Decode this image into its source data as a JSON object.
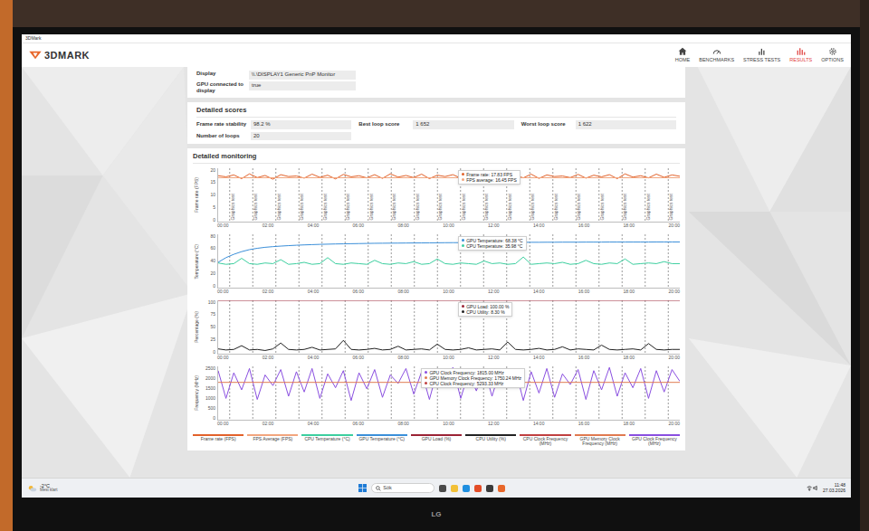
{
  "window": {
    "title": "3DMark"
  },
  "app": {
    "logo": "3DMARK"
  },
  "nav": [
    {
      "label": "HOME",
      "kind": "home",
      "selected": false
    },
    {
      "label": "BENCHMARKS",
      "kind": "gauge",
      "selected": false
    },
    {
      "label": "STRESS TESTS",
      "kind": "bars",
      "selected": false
    },
    {
      "label": "RESULTS",
      "kind": "results",
      "selected": true
    },
    {
      "label": "OPTIONS",
      "kind": "gear",
      "selected": false
    }
  ],
  "display_info": [
    {
      "label": "Display",
      "value": "\\\\.\\DISPLAY1 Generic PnP Monitor"
    },
    {
      "label": "GPU connected to display",
      "value": "true"
    }
  ],
  "scores": {
    "title": "Detailed scores",
    "items": [
      {
        "label": "Frame rate stability",
        "value": "98.2 %"
      },
      {
        "label": "Best loop score",
        "value": "1 652"
      },
      {
        "label": "Worst loop score",
        "value": "1 622"
      },
      {
        "label": "Number of loops",
        "value": "20"
      }
    ]
  },
  "monitoring": {
    "title": "Detailed monitoring",
    "markers": [
      "Graphics test",
      "Graphics test",
      "Graphics test",
      "Graphics test",
      "Graphics test",
      "Graphics test",
      "Graphics test",
      "Graphics test",
      "Graphics test",
      "Graphics test",
      "Graphics test",
      "Graphics test",
      "Graphics test",
      "Graphics test",
      "Graphics test",
      "Graphics test",
      "Graphics test",
      "Graphics test",
      "Graphics test",
      "Graphics test"
    ],
    "x_ticks": [
      "00:00",
      "02:00",
      "04:00",
      "06:00",
      "08:00",
      "10:00",
      "12:00",
      "14:00",
      "16:00",
      "18:00",
      "20:00"
    ],
    "charts": [
      {
        "axis_title": "Frame rate (FPS)",
        "y_ticks": [
          "0",
          "5",
          "10",
          "15",
          "20"
        ],
        "series": [
          {
            "name": "Frame rate",
            "color": "#e2622b",
            "values": [
              17.2,
              16.8,
              17.5,
              16.1,
              17.9,
              16.5,
              17.3,
              15.9,
              17.6,
              16.9,
              17.1,
              16.3,
              17.8,
              16.6,
              17.4,
              16.0,
              17.7,
              16.8,
              17.2,
              16.4,
              17.6,
              16.2,
              17.9,
              16.7,
              17.3,
              16.5,
              17.8,
              16.1,
              17.4,
              16.9,
              17.6,
              16.3,
              17.2,
              16.8,
              17.9,
              16.0,
              17.5,
              16.6,
              17.3,
              16.4,
              17.8,
              16.2,
              17.5,
              16.9,
              17.1,
              16.5,
              17.7,
              16.3,
              17.4,
              16.8,
              17.6,
              16.1,
              17.9,
              16.7,
              17.2,
              16.4,
              17.8,
              16.6,
              17.5,
              17.0
            ]
          },
          {
            "name": "FPS average",
            "color": "#f2a57e",
            "values": [
              16.45,
              16.45
            ]
          }
        ],
        "tooltip": [
          {
            "text": "Frame rate: 17.83 FPS",
            "color": "#e2622b"
          },
          {
            "text": "FPS average: 16.45 FPS",
            "color": "#f2a57e"
          }
        ],
        "tooltip_x": 0.52
      },
      {
        "axis_title": "Temperature (°C)",
        "y_ticks": [
          "0",
          "20",
          "40",
          "60",
          "80"
        ],
        "series": [
          {
            "name": "GPU Temperature",
            "color": "#3b8fd9",
            "values": [
              38,
              45,
              50,
              54,
              57,
              59,
              60.5,
              61.5,
              62.3,
              63,
              63.6,
              64.1,
              64.5,
              64.9,
              65.2,
              65.5,
              65.7,
              65.9,
              66.1,
              66.3,
              66.5,
              66.6,
              66.7,
              66.8,
              66.9,
              67,
              67.1,
              67.2,
              67.3,
              67.4,
              67.5,
              67.5,
              67.6,
              67.7,
              67.7,
              67.8,
              67.8,
              67.9,
              67.9,
              68,
              68,
              68,
              68.1,
              68.1,
              68.2,
              68.2,
              68.2,
              68.3,
              68.3,
              68.3,
              68.4,
              68.4,
              68.4,
              68.4,
              68.4,
              68.4,
              68.5,
              68.5,
              68.5,
              68.5
            ]
          },
          {
            "name": "CPU Temperature",
            "color": "#3ccf9f",
            "values": [
              37,
              35,
              36,
              44,
              36,
              35,
              37,
              36,
              42,
              35,
              36,
              38,
              35,
              36,
              45,
              36,
              35,
              37,
              36,
              35,
              41,
              36,
              35,
              37,
              36,
              39,
              35,
              36,
              43,
              36,
              35,
              37,
              36,
              35,
              40,
              36,
              37,
              35,
              36,
              46,
              35,
              36,
              37,
              36,
              38,
              35,
              36,
              41,
              36,
              35,
              37,
              36,
              43,
              35,
              36,
              37,
              36,
              39,
              36,
              36
            ]
          }
        ],
        "tooltip": [
          {
            "text": "GPU Temperature: 68.38 °C",
            "color": "#3b8fd9"
          },
          {
            "text": "CPU Temperature: 35.98 °C",
            "color": "#3ccf9f"
          }
        ],
        "tooltip_x": 0.52
      },
      {
        "axis_title": "Percentage (%)",
        "y_ticks": [
          "0",
          "25",
          "50",
          "75",
          "100"
        ],
        "series": [
          {
            "name": "GPU Load",
            "color": "#9b2335",
            "values": [
              100,
              100
            ]
          },
          {
            "name": "CPU Utility",
            "color": "#222222",
            "values": [
              9,
              7,
              8,
              15,
              7,
              8,
              6,
              9,
              20,
              8,
              7,
              8,
              12,
              7,
              8,
              9,
              25,
              8,
              7,
              8,
              10,
              7,
              8,
              14,
              7,
              8,
              9,
              7,
              18,
              8,
              7,
              8,
              11,
              7,
              8,
              9,
              7,
              22,
              8,
              7,
              8,
              10,
              7,
              8,
              13,
              7,
              9,
              8,
              7,
              16,
              8,
              7,
              8,
              9,
              7,
              19,
              8,
              7,
              8,
              8
            ]
          }
        ],
        "tooltip": [
          {
            "text": "GPU Load: 100.00 %",
            "color": "#9b2335"
          },
          {
            "text": "CPU Utility: 8.30 %",
            "color": "#222222"
          }
        ],
        "tooltip_x": 0.52
      },
      {
        "axis_title": "Frequency (MHz)",
        "y_ticks": [
          "0",
          "500",
          "1000",
          "1500",
          "2000",
          "2500"
        ],
        "series": [
          {
            "name": "GPU Clock Frequency",
            "color": "#8a4fe0",
            "values": [
              2300,
              1000,
              2200,
              1400,
              2400,
              950,
              2100,
              1600,
              2350,
              1100,
              2250,
              1300,
              2400,
              1000,
              2150,
              1500,
              2300,
              900,
              2200,
              1450,
              2350,
              1050,
              2100,
              1700,
              2400,
              1200,
              2250,
              950,
              2300,
              1600,
              2450,
              1000,
              2200,
              1350,
              2400,
              1100,
              2300,
              1550,
              2350,
              900,
              2250,
              1250,
              2400,
              1050,
              2150,
              1650,
              2350,
              950,
              2300,
              1400,
              2450,
              1100,
              2200,
              1500,
              2400,
              1000,
              2300,
              1300,
              2350,
              1800
            ]
          },
          {
            "name": "GPU Memory Clock Frequency",
            "color": "#e07a50",
            "values": [
              1750.24,
              1750.24
            ]
          }
        ],
        "tooltip": [
          {
            "text": "GPU Clock Frequency: 1815.00 MHz",
            "color": "#8a4fe0"
          },
          {
            "text": "GPU Memory Clock Frequency: 1750.24 MHz",
            "color": "#e07a50"
          },
          {
            "text": "CPU Clock Frequency: 5293.33 MHz",
            "color": "#c04040"
          }
        ],
        "tooltip_x": 0.44
      }
    ],
    "legend": [
      {
        "label": "Frame rate (FPS)",
        "color": "#e2622b"
      },
      {
        "label": "FPS Average (FPS)",
        "color": "#f2a57e"
      },
      {
        "label": "CPU Temperature (°C)",
        "color": "#3ccf9f"
      },
      {
        "label": "GPU Temperature (°C)",
        "color": "#3b8fd9"
      },
      {
        "label": "GPU Load (%)",
        "color": "#9b2335"
      },
      {
        "label": "CPU Utility (%)",
        "color": "#222222"
      },
      {
        "label": "CPU Clock Frequency (MHz)",
        "color": "#c04040"
      },
      {
        "label": "GPU Memory Clock Frequency (MHz)",
        "color": "#e07a50"
      },
      {
        "label": "GPU Clock Frequency (MHz)",
        "color": "#8a4fe0"
      }
    ]
  },
  "taskbar": {
    "weather": "-2°C",
    "weather_note": "Mest klart",
    "search": "Sök",
    "time": "11:48",
    "date": "27.03.2026"
  },
  "monitor": {
    "brand": "LG"
  }
}
